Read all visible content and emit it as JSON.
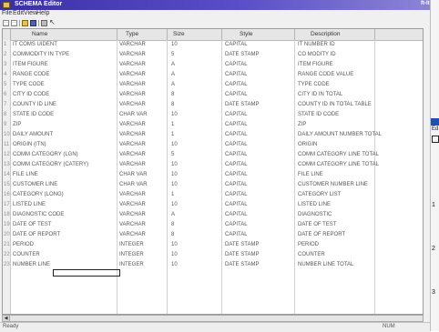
{
  "window": {
    "title": "SCHEMA Editor",
    "title_right": "ft-lt"
  },
  "menu": [
    "File",
    "Edit",
    "View",
    "Help"
  ],
  "table": {
    "columns": [
      "Name",
      "Type",
      "Size",
      "Style",
      "Description"
    ],
    "rows": [
      {
        "idx": "1",
        "name": "IT COMS UIDENT",
        "type": "VARCHAR",
        "size": "10",
        "style": "CAPITAL",
        "desc": "IT NUMBER ID"
      },
      {
        "idx": "2",
        "name": "COMMODITY IN TYPE",
        "type": "VARCHAR",
        "size": "5",
        "style": "DATE STAMP",
        "desc": "CO MODITY ID"
      },
      {
        "idx": "3",
        "name": "ITEM FIGURE",
        "type": "VARCHAR",
        "size": "A",
        "style": "CAPITAL",
        "desc": "ITEM FIGURE"
      },
      {
        "idx": "4",
        "name": "RANGE CODE",
        "type": "VARCHAR",
        "size": "A",
        "style": "CAPITAL",
        "desc": "RANGE CODE VALUE"
      },
      {
        "idx": "5",
        "name": "TYPE CODE",
        "type": "VARCHAR",
        "size": "A",
        "style": "CAPITAL",
        "desc": "TYPE CODE"
      },
      {
        "idx": "6",
        "name": "CITY ID CODE",
        "type": "VARCHAR",
        "size": "8",
        "style": "CAPITAL",
        "desc": "CITY ID IN TOTAL"
      },
      {
        "idx": "7",
        "name": "COUNTY ID LINE",
        "type": "VARCHAR",
        "size": "8",
        "style": "DATE STAMP",
        "desc": "COUNTY ID IN TOTAL TABLE"
      },
      {
        "idx": "8",
        "name": "STATE ID CODE",
        "type": "CHAR VAR",
        "size": "10",
        "style": "CAPITAL",
        "desc": "STATE ID CODE"
      },
      {
        "idx": "9",
        "name": "ZIP",
        "type": "VARCHAR",
        "size": "1",
        "style": "CAPITAL",
        "desc": "ZIP"
      },
      {
        "idx": "10",
        "name": "DAILY AMOUNT",
        "type": "VARCHAR",
        "size": "1",
        "style": "CAPITAL",
        "desc": "DAILY AMOUNT NUMBER TOTAL"
      },
      {
        "idx": "11",
        "name": "ORIGIN (ITN)",
        "type": "VARCHAR",
        "size": "10",
        "style": "CAPITAL",
        "desc": "ORIGIN"
      },
      {
        "idx": "12",
        "name": "COMM CATEGORY (LGN)",
        "type": "VARCHAR",
        "size": "5",
        "style": "CAPITAL",
        "desc": "COMM CATEGORY LINE TOTAL"
      },
      {
        "idx": "13",
        "name": "COMM CATEGORY (CATERY)",
        "type": "VARCHAR",
        "size": "10",
        "style": "CAPITAL",
        "desc": "COMM CATEGORY LINE TOTAL"
      },
      {
        "idx": "14",
        "name": "FILE LINE",
        "type": "CHAR VAR",
        "size": "10",
        "style": "CAPITAL",
        "desc": "FILE LINE"
      },
      {
        "idx": "15",
        "name": "CUSTOMER LINE",
        "type": "CHAR VAR",
        "size": "10",
        "style": "CAPITAL",
        "desc": "CUSTOMER NUMBER LINE"
      },
      {
        "idx": "16",
        "name": "CATEGORY (LONG)",
        "type": "VARCHAR",
        "size": "1",
        "style": "CAPITAL",
        "desc": "CATEGORY LIST"
      },
      {
        "idx": "17",
        "name": "LISTED LINE",
        "type": "VARCHAR",
        "size": "10",
        "style": "CAPITAL",
        "desc": "LISTED LINE"
      },
      {
        "idx": "18",
        "name": "DIAGNOSTIC CODE",
        "type": "VARCHAR",
        "size": "A",
        "style": "CAPITAL",
        "desc": "DIAGNOSTIC"
      },
      {
        "idx": "19",
        "name": "DATE OF TEST",
        "type": "VARCHAR",
        "size": "8",
        "style": "CAPITAL",
        "desc": "DATE OF TEST"
      },
      {
        "idx": "20",
        "name": "DATE OF REPORT",
        "type": "VARCHAR",
        "size": "8",
        "style": "CAPITAL",
        "desc": "DATE OF REPORT"
      },
      {
        "idx": "21",
        "name": "PERIOD",
        "type": "INTEGER",
        "size": "10",
        "style": "DATE STAMP",
        "desc": "PERIOD"
      },
      {
        "idx": "22",
        "name": "COUNTER",
        "type": "INTEGER",
        "size": "10",
        "style": "DATE STAMP",
        "desc": "COUNTER"
      },
      {
        "idx": "23",
        "name": "NUMBER LINE",
        "type": "INTEGER",
        "size": "10",
        "style": "DATE STAMP",
        "desc": "NUMBER LINE TOTAL"
      }
    ]
  },
  "status": {
    "left": "Ready",
    "right": "NUM"
  },
  "right_panel": {
    "menu": "Ed",
    "numbers": [
      "1",
      "2",
      "3"
    ]
  },
  "colors": {
    "title_bar": "#3a2fa6",
    "selection_border": "#222222",
    "right_panel_title": "#1d4fb8"
  }
}
